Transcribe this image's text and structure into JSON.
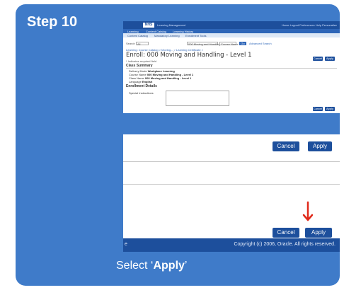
{
  "step": {
    "title": "Step 10"
  },
  "caption": {
    "prefix": "Select ‘",
    "bold": "Apply",
    "suffix": "’"
  },
  "screenshot": {
    "header": {
      "logo": "NHS",
      "app_name": "Learning Management",
      "links": "Home  Logout  Preferences  Help  Personalize"
    },
    "tabs": [
      "Learning",
      "Content Catalog",
      "Learning History"
    ],
    "subtabs": [
      "Content Catalog",
      "Mandatory Learning",
      "Enrollment Tools"
    ],
    "search": {
      "label": "Search",
      "scope": "All",
      "value": "000 Moving and Handling",
      "option": "Course Name",
      "go": "Go",
      "advanced": "Advanced Search"
    },
    "breadcrumb": "Learning: Course Catalog > Moving... > Learning Certificate >",
    "page_title": "Enroll: 000 Moving and Handling - Level 1",
    "hint": "* Indicates required field",
    "buttons": {
      "cancel": "Cancel",
      "apply": "Apply"
    },
    "class_summary": {
      "heading": "Class Summary",
      "rows": [
        {
          "label": "Delivery Mode",
          "value": "Workplace Learning"
        },
        {
          "label": "Course Name",
          "value": "000 Moving and Handling - Level 1"
        },
        {
          "label": "Class Name",
          "value": "000 Moving and Handling - Level 1"
        },
        {
          "label": "Language",
          "value": "English"
        }
      ]
    },
    "enrollment": {
      "heading": "Enrollment Details",
      "field_label": "Special Instructions"
    },
    "footer": {
      "left": "e",
      "copyright": "Copyright (c) 2006, Oracle. All rights reserved."
    }
  },
  "colors": {
    "card": "#3f7bc9",
    "header": "#1d4f9c",
    "arrow": "#e02a1b"
  }
}
